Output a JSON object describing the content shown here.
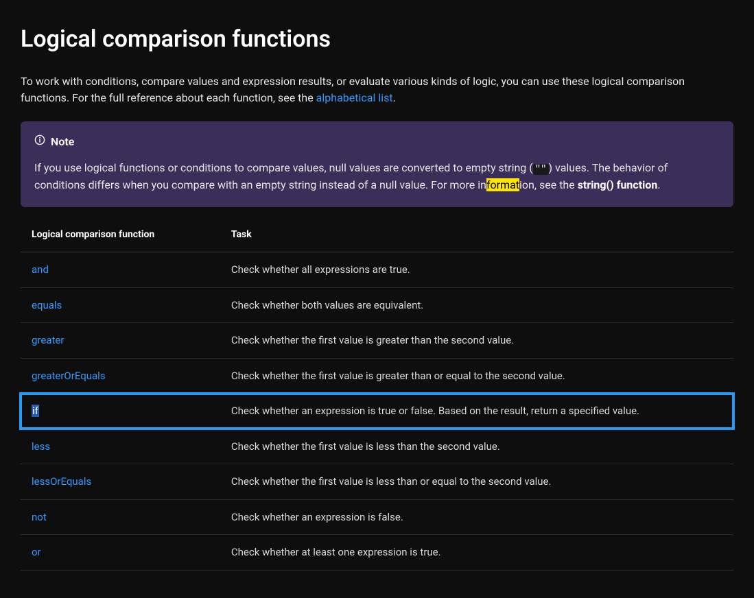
{
  "heading": "Logical comparison functions",
  "intro_before_link": "To work with conditions, compare values and expression results, or evaluate various kinds of logic, you can use these logical comparison functions. For the full reference about each function, see the ",
  "intro_link": "alphabetical list",
  "intro_after_link": ".",
  "note": {
    "label": "Note",
    "body_prefix": "If you use logical functions or conditions to compare values, null values are converted to empty string (",
    "code": "\"\"",
    "body_mid1": ") values. The behavior of conditions differs when you compare with an empty string instead of a null value. For more in",
    "highlight": "format",
    "body_mid2": "ion, see the ",
    "strong": "string() function",
    "body_suffix": "."
  },
  "table": {
    "head_fn": "Logical comparison function",
    "head_task": "Task",
    "rows": [
      {
        "fn": "and",
        "task": "Check whether all expressions are true.",
        "hl": false
      },
      {
        "fn": "equals",
        "task": "Check whether both values are equivalent.",
        "hl": false
      },
      {
        "fn": "greater",
        "task": "Check whether the first value is greater than the second value.",
        "hl": false
      },
      {
        "fn": "greaterOrEquals",
        "task": "Check whether the first value is greater than or equal to the second value.",
        "hl": false
      },
      {
        "fn": "if",
        "task": "Check whether an expression is true or false. Based on the result, return a specified value.",
        "hl": true
      },
      {
        "fn": "less",
        "task": "Check whether the first value is less than the second value.",
        "hl": false
      },
      {
        "fn": "lessOrEquals",
        "task": "Check whether the first value is less than or equal to the second value.",
        "hl": false
      },
      {
        "fn": "not",
        "task": "Check whether an expression is false.",
        "hl": false
      },
      {
        "fn": "or",
        "task": "Check whether at least one expression is true.",
        "hl": false
      }
    ]
  }
}
